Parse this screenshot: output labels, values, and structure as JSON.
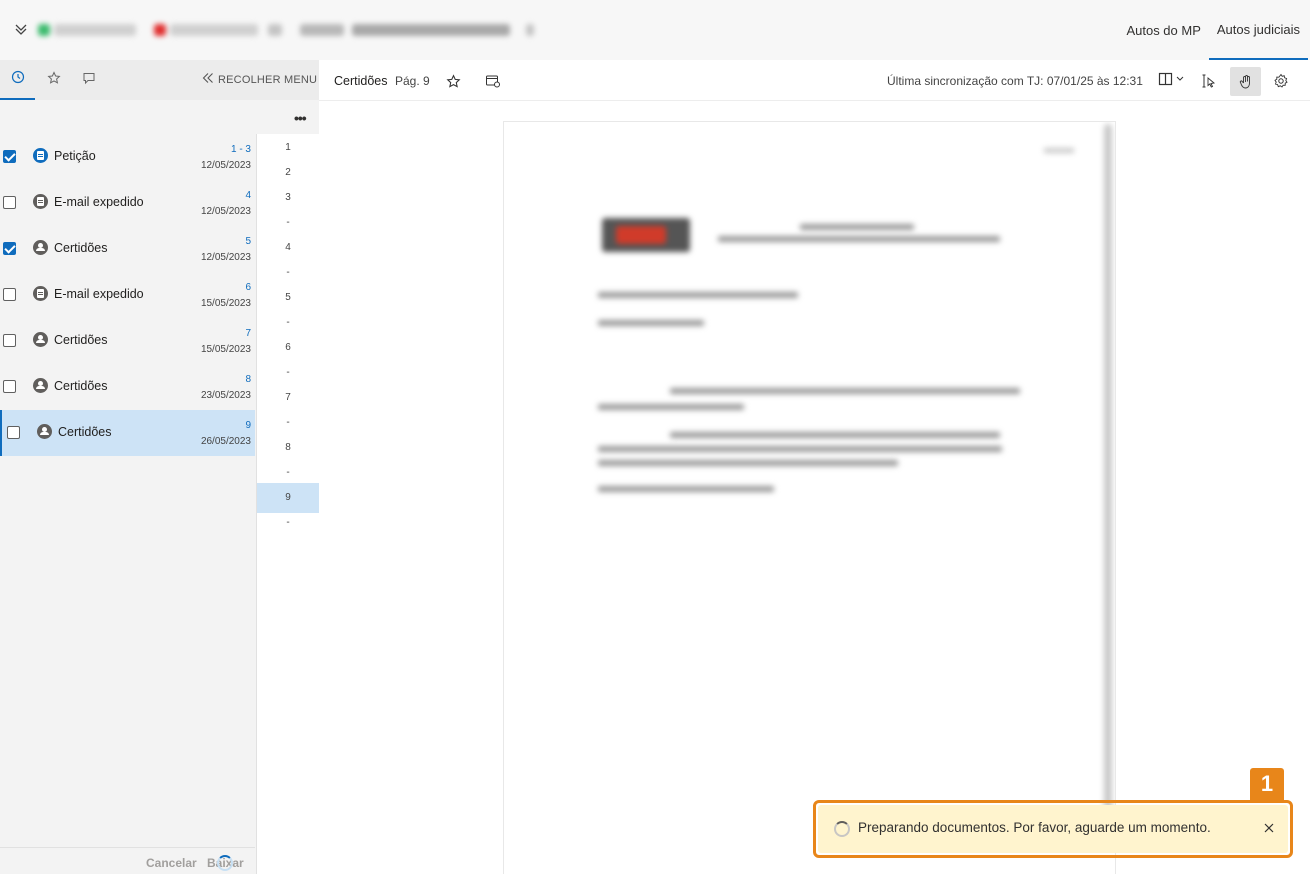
{
  "topbar": {
    "tabs": [
      {
        "label": "Autos do MP",
        "active": false
      },
      {
        "label": "Autos judiciais",
        "active": true
      }
    ]
  },
  "sidebar": {
    "collapse_label": "RECOLHER MENU",
    "documents": [
      {
        "name": "Petição",
        "pages": "1 - 3",
        "date": "12/05/2023",
        "checked": true,
        "icon": "document-icon",
        "selected": false
      },
      {
        "name": "E-mail expedido",
        "pages": "4",
        "date": "12/05/2023",
        "checked": false,
        "icon": "document-icon",
        "selected": false
      },
      {
        "name": "Certidões",
        "pages": "5",
        "date": "12/05/2023",
        "checked": true,
        "icon": "person-icon",
        "selected": false
      },
      {
        "name": "E-mail expedido",
        "pages": "6",
        "date": "15/05/2023",
        "checked": false,
        "icon": "document-icon",
        "selected": false
      },
      {
        "name": "Certidões",
        "pages": "7",
        "date": "15/05/2023",
        "checked": false,
        "icon": "person-icon",
        "selected": false
      },
      {
        "name": "Certidões",
        "pages": "8",
        "date": "23/05/2023",
        "checked": false,
        "icon": "person-icon",
        "selected": false
      },
      {
        "name": "Certidões",
        "pages": "9",
        "date": "26/05/2023",
        "checked": false,
        "icon": "person-icon",
        "selected": true
      }
    ],
    "page_numbers": [
      "1",
      "2",
      "3",
      "-",
      "4",
      "-",
      "5",
      "-",
      "6",
      "-",
      "7",
      "-",
      "8",
      "-",
      "9",
      "-"
    ],
    "selected_page": "9",
    "footer": {
      "cancel_label": "Cancelar",
      "download_label": "Baixar"
    }
  },
  "viewer": {
    "title": "Certidões",
    "page_label": "Pág. 9",
    "sync_text": "Última sincronização com TJ: 07/01/25 às 12:31"
  },
  "toast": {
    "message": "Preparando documentos. Por favor, aguarde um momento.",
    "badge": "1"
  },
  "colors": {
    "accent": "#0f6cbd",
    "highlight_orange": "#e8861a",
    "toast_bg": "#fff4ce",
    "selected_row": "#cde3f6"
  }
}
